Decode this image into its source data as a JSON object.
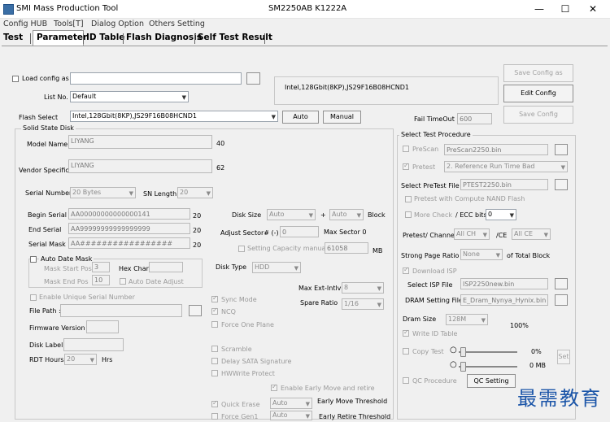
{
  "window": {
    "title": "SMI Mass Production Tool",
    "center_title": "SM2250AB   K1222A",
    "minimize": "—",
    "maximize": "☐",
    "close": "✕"
  },
  "menu": [
    "Config HUB",
    "Tools[T]",
    "Dialog Option",
    "Others Setting"
  ],
  "tabs": [
    "Test",
    "Parameter",
    "ID Table",
    "Flash Diagnosis",
    "Self Test Result"
  ],
  "top": {
    "load_config_label": "Load config as",
    "load_config_value": "",
    "list_no_label": "List No.",
    "list_no_value": "Default",
    "flash_info": "Intel,128Gbit(8KP),JS29F16B08HCND1",
    "flash_select_label": "Flash Select",
    "flash_select_value": "Intel,128Gbit(8KP),JS29F16B08HCND1",
    "auto_button": "Auto",
    "manual_button": "Manual",
    "save_config_as_button": "Save Config as",
    "edit_config_button": "Edit Config",
    "save_config_button": "Save Config",
    "fail_timeout_label": "Fail TimeOut",
    "fail_timeout_value": "600"
  },
  "ssd": {
    "group_label": "Solid State Disk",
    "model_name_label": "Model Name",
    "model_name_value": "LIYANG",
    "model_name_len": "40",
    "vendor_label": "Vendor Specific",
    "vendor_value": "LIYANG",
    "vendor_len": "62",
    "serial_number_label": "Serial Number",
    "serial_number_value": "20 Bytes",
    "sn_length_label": "SN Length",
    "sn_length_value": "20",
    "begin_serial_label": "Begin Serial",
    "begin_serial_value": "AA00000000000000141",
    "begin_serial_len": "20",
    "end_serial_label": "End Serial",
    "end_serial_value": "AA99999999999999999",
    "end_serial_len": "20",
    "serial_mask_label": "Serial Mask",
    "serial_mask_value": "AA#################",
    "serial_mask_len": "20",
    "auto_date_mask_label": "Auto Date Mask",
    "mask_start_label": "Mask Start Pos",
    "mask_start_value": "3",
    "hex_char_label": "Hex Char:",
    "mask_end_label": "Mask End Pos",
    "mask_end_value": "10",
    "auto_date_adjust_label": "Auto Date Adjust",
    "enable_unique_label": "Enable Unique Serial Number",
    "file_path_label": "File Path :",
    "firmware_version_label": "Firmware Version",
    "disk_label_label": "Disk Label",
    "rdt_hours_label": "RDT Hours",
    "rdt_hours_value": "20",
    "hrs_label": "Hrs",
    "disk_size_label": "Disk Size",
    "disk_size_value": "Auto",
    "plus": "+",
    "disk_size_value2": "Auto",
    "block_label": "Block",
    "adjust_sector_label": "Adjust Sector# (-)",
    "adjust_sector_value": "0",
    "max_sector_label": "Max Sector 0",
    "setting_capacity_label": "Setting Capacity manually",
    "capacity_value": "61058",
    "mb_label": "MB",
    "disk_type_label": "Disk Type",
    "disk_type_value": "HDD",
    "max_ext_label": "Max Ext-Intlv",
    "max_ext_value": "8",
    "spare_ratio_label": "Spare Ratio",
    "spare_ratio_value": "1/16",
    "sync_mode_label": "Sync Mode",
    "ncq_label": "NCQ",
    "force_one_plane_label": "Force One Plane",
    "scramble_label": "Scramble",
    "delay_sata_label": "Delay SATA Signature",
    "hw_write_label": "HWWrite Protect",
    "enable_early_label": "Enable Early Move and retire",
    "quick_erase_label": "Quick Erase",
    "quick_erase_value": "Auto",
    "early_move_label": "Early Move Threshold",
    "force_gen1_label": "Force Gen1",
    "force_gen1_value": "Auto",
    "early_retire_label": "Early Retire Threshold"
  },
  "procedure": {
    "group_label": "Select Test Procedure",
    "prescan_label": "PreScan",
    "prescan_value": "PreScan2250.bin",
    "pretest_label": "Pretest",
    "pretest_value": "2. Reference Run Time Bad",
    "select_pretest_label": "Select PreTest File",
    "select_pretest_value": "PTEST2250.bin",
    "pretest_compute_label": "Pretest with Compute NAND Flash",
    "more_check_label": "More Check",
    "ecc_bits_label": "/ ECC bits",
    "ecc_bits_value": "0",
    "pretest_channel_label": "Pretest/ Channel",
    "channel_value": "All CH",
    "ce_label": "/CE",
    "ce_value": "All CE",
    "strong_page_label": "Strong Page Ratio :",
    "strong_page_value": "None",
    "total_block_label": "of Total Block",
    "download_isp_label": "Download ISP",
    "select_isp_label": "Select ISP File",
    "select_isp_value": "ISP2250new.bin",
    "dram_setting_label": "DRAM Setting File",
    "dram_setting_value": "E_Dram_Nynya_Hynix.bin",
    "dram_size_label": "Dram Size",
    "dram_size_value": "128M",
    "percent_label": "100%",
    "write_id_label": "Write ID Table",
    "copy_test_label": "Copy Test",
    "copy_pct": "0%",
    "copy_mb": "0 MB",
    "set_button": "Set",
    "qc_procedure_label": "QC Procedure",
    "qc_setting_button": "QC Setting"
  },
  "watermark": "最需教育",
  "icons": {
    "dropdown": "▼",
    "check": "✓"
  }
}
